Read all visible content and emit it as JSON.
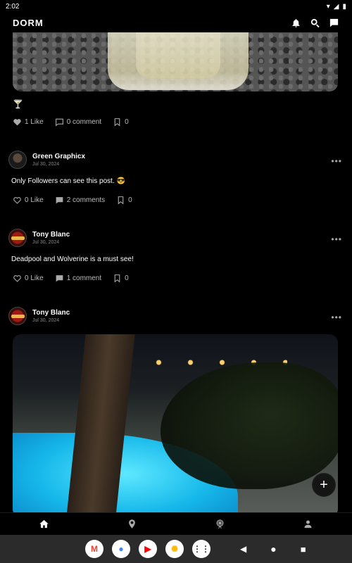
{
  "status_bar": {
    "time": "2:02"
  },
  "app": {
    "title": "DORM"
  },
  "posts": [
    {
      "text": "🍸",
      "likes": "1 Like",
      "comments": "0 comment",
      "saves": "0"
    },
    {
      "author": "Green Graphicx",
      "date": "Jul 30, 2024",
      "text": "Only Followers can see this post. 😎",
      "likes": "0 Like",
      "comments": "2 comments",
      "saves": "0"
    },
    {
      "author": "Tony Blanc",
      "date": "Jul 30, 2024",
      "text": "Deadpool and Wolverine is a must see!",
      "likes": "0 Like",
      "comments": "1 comment",
      "saves": "0"
    },
    {
      "author": "Tony Blanc",
      "date": "Jul 30, 2024"
    }
  ],
  "fab": {
    "label": "+"
  },
  "more_label": "•••",
  "dock_apps": [
    {
      "name": "Gmail",
      "glyph": "M",
      "color": "#ea4335"
    },
    {
      "name": "Chrome",
      "glyph": "●",
      "color": "#4285f4"
    },
    {
      "name": "YouTube",
      "glyph": "▶",
      "color": "#ff0000"
    },
    {
      "name": "Photos",
      "glyph": "✺",
      "color": "#fbbc05"
    },
    {
      "name": "Apps",
      "glyph": "⋮⋮",
      "color": "#333333"
    }
  ],
  "icons": {
    "header": [
      "bell-icon",
      "search-icon",
      "chat-icon"
    ],
    "bottom_nav": [
      "home-icon",
      "location-pin-icon",
      "ferris-wheel-icon",
      "profile-icon"
    ]
  }
}
